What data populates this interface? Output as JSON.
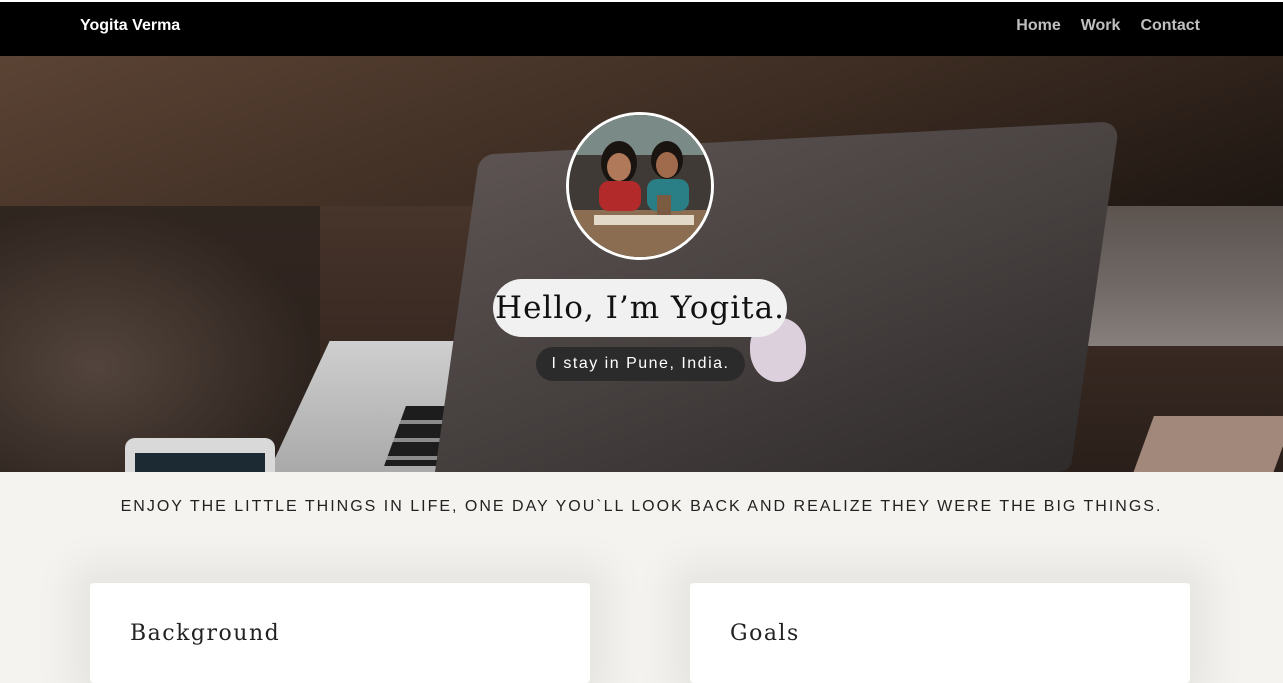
{
  "header": {
    "brand": "Yogita Verma",
    "nav": [
      "Home",
      "Work",
      "Contact"
    ]
  },
  "hero": {
    "avatar_alt": "profile photo",
    "greeting": "Hello, I’m Yogita.",
    "location": "I stay in Pune, India."
  },
  "quote": "ENJOY THE LITTLE THINGS IN LIFE, ONE DAY YOU`LL LOOK BACK AND REALIZE THEY WERE THE BIG THINGS.",
  "cards": [
    {
      "title": "Background"
    },
    {
      "title": "Goals"
    }
  ],
  "colors": {
    "navbar": "#000000",
    "page_bg": "#f4f3ef",
    "card_bg": "#ffffff",
    "greeting_pill": "#f1f1f1",
    "location_pill": "#2b2b2b"
  }
}
